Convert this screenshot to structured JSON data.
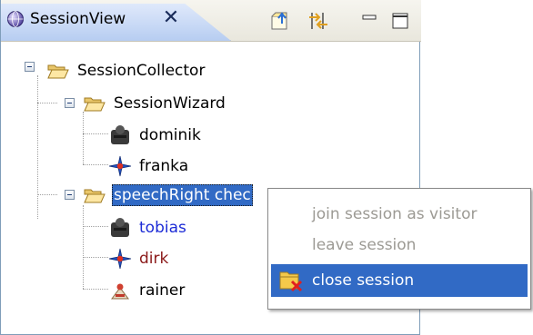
{
  "view": {
    "title": "SessionView",
    "toolbar": [
      "export-icon",
      "sync-icon",
      "minimize-icon",
      "maximize-icon"
    ]
  },
  "tree": {
    "root": {
      "label": "SessionCollector",
      "icon": "folder-open-icon"
    },
    "groups": [
      {
        "label": "SessionWizard",
        "icon": "folder-open-icon",
        "children": [
          {
            "label": "dominik",
            "icon": "session-user-icon",
            "color": "#000000"
          },
          {
            "label": "franka",
            "icon": "compass-star-icon",
            "color": "#000000"
          }
        ]
      },
      {
        "label": "speechRight chec",
        "icon": "folder-open-icon",
        "selected": true,
        "children": [
          {
            "label": "tobias",
            "icon": "session-user-icon",
            "color": "#1c2bd6"
          },
          {
            "label": "dirk",
            "icon": "compass-star-icon",
            "color": "#8b1a1a"
          },
          {
            "label": "rainer",
            "icon": "visitor-icon",
            "color": "#000000"
          }
        ]
      }
    ]
  },
  "context_menu": {
    "items": [
      {
        "label": "join session as visitor",
        "enabled": false
      },
      {
        "label": "leave session",
        "enabled": false
      },
      {
        "label": "close session",
        "enabled": true,
        "active": true,
        "icon": "close-folder-icon"
      }
    ]
  },
  "colors": {
    "selection": "#316ac5",
    "menu_disabled_text": "#9c9a94",
    "tab_gradient_top": "#dfe9fb",
    "tab_gradient_bottom": "#b7cdf1"
  }
}
